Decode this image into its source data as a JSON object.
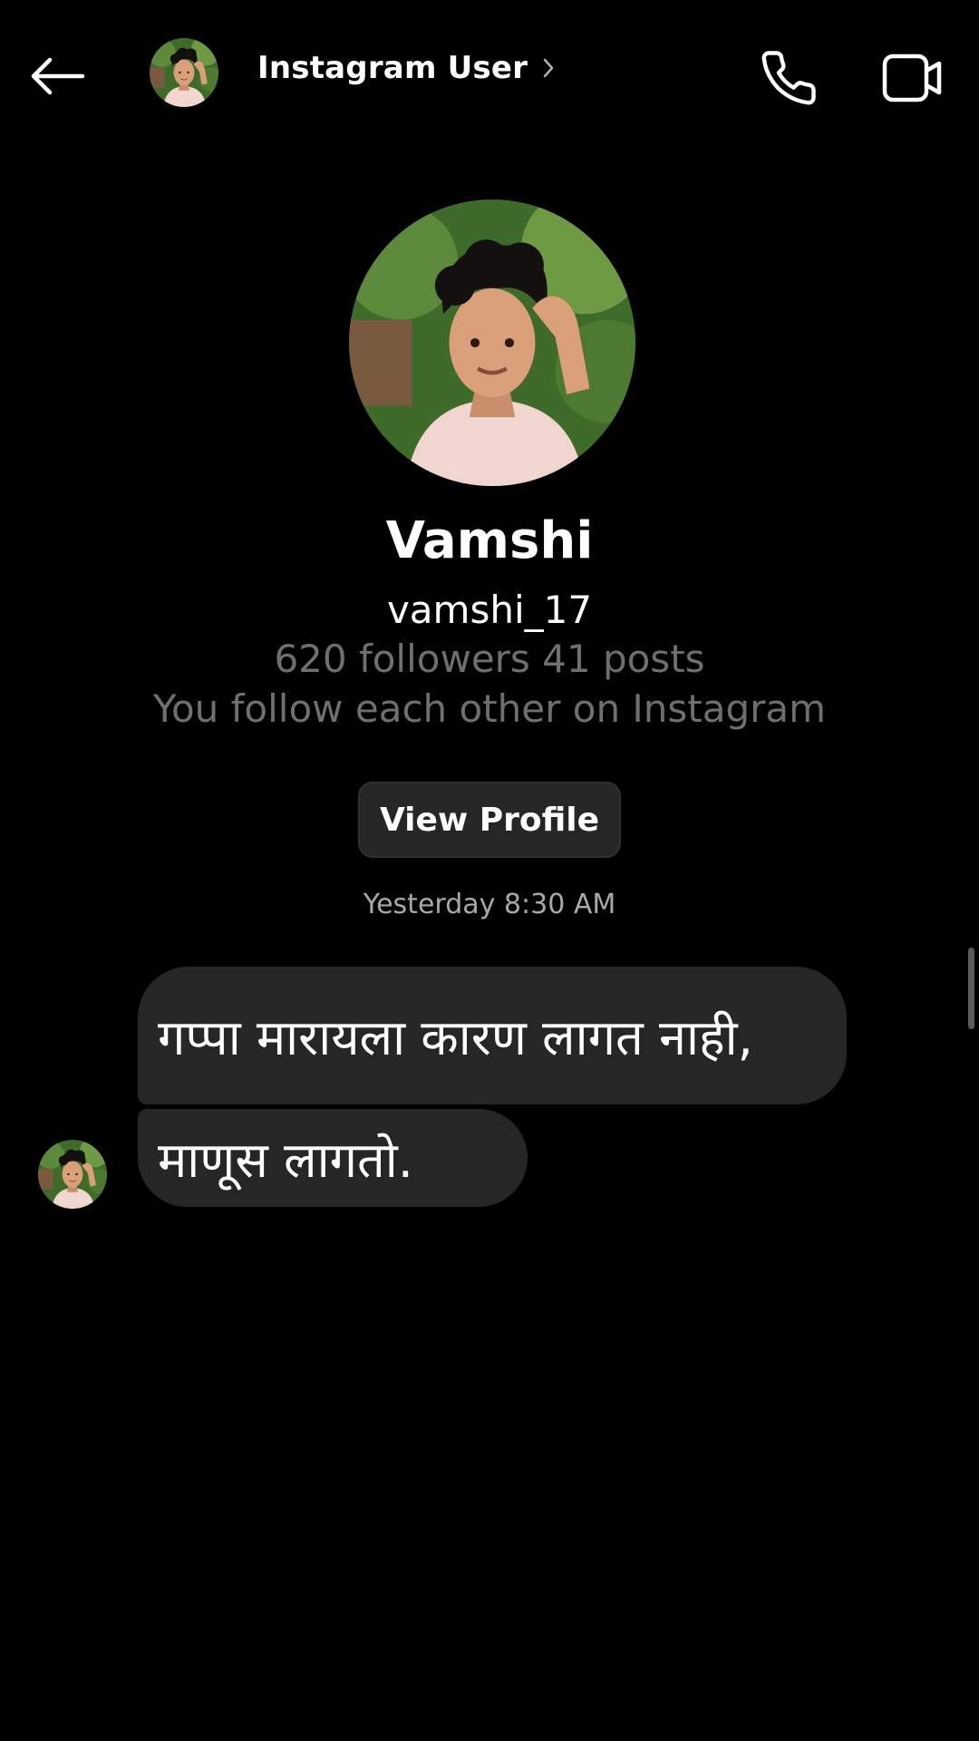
{
  "header": {
    "back_icon": "arrow-left-icon",
    "title": "Instagram User",
    "chevron_icon": "chevron-right-icon",
    "call_icon": "phone-icon",
    "video_icon": "video-camera-icon"
  },
  "profile": {
    "name": "Vamshi",
    "username": "vamshi_17",
    "stats": "620 followers 41 posts",
    "mutual": "You follow each other on Instagram",
    "view_profile_label": "View Profile"
  },
  "thread": {
    "timestamp": "Yesterday 8:30 AM",
    "messages": [
      {
        "text": "गप्पा मारायला कारण लागत नाही,"
      },
      {
        "text": "माणूस लागतो."
      }
    ]
  },
  "colors": {
    "background": "#000000",
    "bubble": "#262626",
    "secondary_text": "#6f6f6f",
    "timestamp_text": "#a8a8a8"
  }
}
